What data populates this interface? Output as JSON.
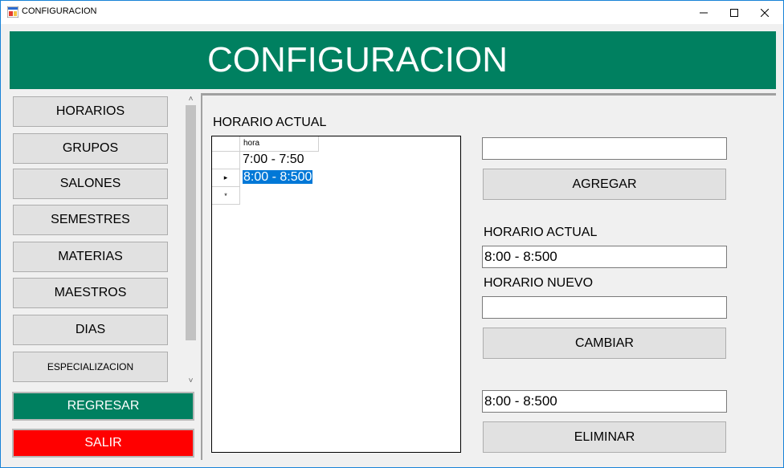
{
  "window": {
    "title": "CONFIGURACION",
    "icon": "app-form-icon",
    "controls": [
      "minimize-icon",
      "maximize-icon",
      "close-icon"
    ]
  },
  "banner": {
    "title": "CONFIGURACION",
    "color": "#008060"
  },
  "sidebar": {
    "items": [
      {
        "label": "HORARIOS"
      },
      {
        "label": "GRUPOS"
      },
      {
        "label": "SALONES"
      },
      {
        "label": "SEMESTRES"
      },
      {
        "label": "MATERIAS"
      },
      {
        "label": "MAESTROS"
      },
      {
        "label": "DIAS"
      },
      {
        "label": "ESPECIALIZACION"
      }
    ],
    "scroll_up": "˄",
    "scroll_down": "˅"
  },
  "actions": {
    "back_label": "REGRESAR",
    "back_color": "#008060",
    "exit_label": "SALIR",
    "exit_color": "#ff0000"
  },
  "main": {
    "grid_title": "HORARIO ACTUAL",
    "grid": {
      "column_header": "hora",
      "rows": [
        {
          "marker": "",
          "value": "7:00 - 7:50",
          "selected": false
        },
        {
          "marker": "▸",
          "value": "8:00 - 8:500",
          "selected": true
        },
        {
          "marker": "*",
          "value": "",
          "selected": false
        }
      ]
    },
    "add_input": {
      "value": ""
    },
    "add_button": "AGREGAR",
    "current_label": "HORARIO ACTUAL",
    "current_input": {
      "value": "8:00 - 8:500"
    },
    "new_label": "HORARIO NUEVO",
    "new_input": {
      "value": ""
    },
    "change_button": "CAMBIAR",
    "delete_input": {
      "value": "8:00 - 8:500"
    },
    "delete_button": "ELIMINAR"
  }
}
